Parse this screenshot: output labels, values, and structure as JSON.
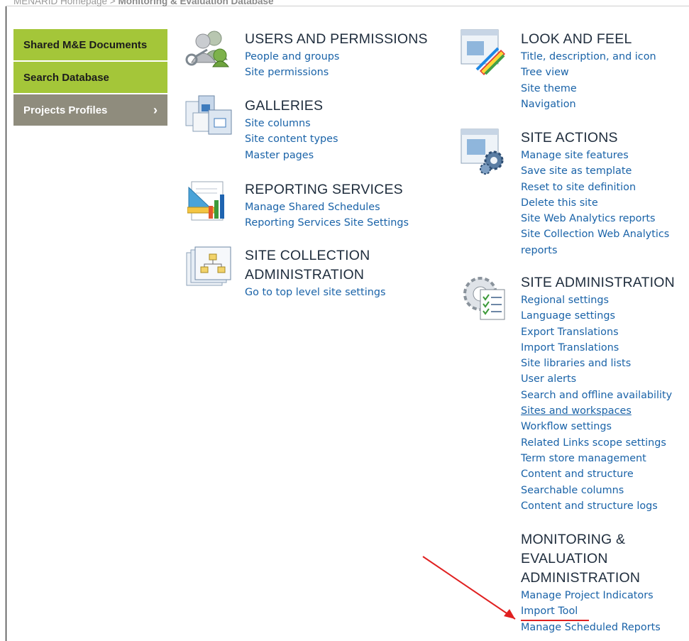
{
  "breadcrumb": {
    "root": "MENARID Homepage",
    "sep": ">",
    "current": "Monitoring & Evaluation Database"
  },
  "leftnav": [
    {
      "label": "Shared M&E Documents"
    },
    {
      "label": "Search Database"
    },
    {
      "label": "Projects Profiles",
      "chevron": "›"
    }
  ],
  "sections": {
    "users": {
      "title": "USERS AND PERMISSIONS",
      "icon": "users-keys-icon",
      "links": [
        "People and groups",
        "Site permissions"
      ]
    },
    "galleries": {
      "title": "GALLERIES",
      "icon": "galleries-icon",
      "links": [
        "Site columns",
        "Site content types",
        "Master pages"
      ]
    },
    "reporting": {
      "title": "REPORTING SERVICES",
      "icon": "reporting-services-icon",
      "links": [
        "Manage Shared Schedules",
        "Reporting Services Site Settings"
      ]
    },
    "sitecollection": {
      "title_line1": "SITE COLLECTION",
      "title_line2": "ADMINISTRATION",
      "icon": "site-collection-icon",
      "links": [
        "Go to top level site settings"
      ]
    },
    "look": {
      "title": "LOOK AND FEEL",
      "icon": "look-and-feel-icon",
      "links": [
        "Title, description, and icon",
        "Tree view",
        "Site theme",
        "Navigation"
      ]
    },
    "actions": {
      "title": "SITE ACTIONS",
      "icon": "site-actions-icon",
      "links": [
        "Manage site features",
        "Save site as template",
        "Reset to site definition",
        "Delete this site",
        "Site Web Analytics reports",
        "Site Collection Web Analytics",
        "reports"
      ]
    },
    "admin": {
      "title": "SITE ADMINISTRATION",
      "icon": "site-administration-icon",
      "links": [
        "Regional settings",
        "Language settings",
        "Export Translations",
        "Import Translations",
        "Site libraries and lists",
        "User alerts",
        "Search and offline availability",
        "Sites and workspaces",
        "Workflow settings",
        "Related Links scope settings",
        "Term store management",
        "Content and structure",
        "Searchable columns",
        "Content and structure logs"
      ]
    },
    "me": {
      "title_line1": "MONITORING &",
      "title_line2": "EVALUATION",
      "title_line3": "ADMINISTRATION",
      "links": [
        "Manage Project Indicators",
        "Import Tool",
        "Manage Scheduled Reports"
      ]
    }
  },
  "colors": {
    "link": "#1a63a8",
    "nav_green": "#a4c639",
    "nav_grey": "#8f8c7d",
    "annotation_red": "#e02020"
  }
}
